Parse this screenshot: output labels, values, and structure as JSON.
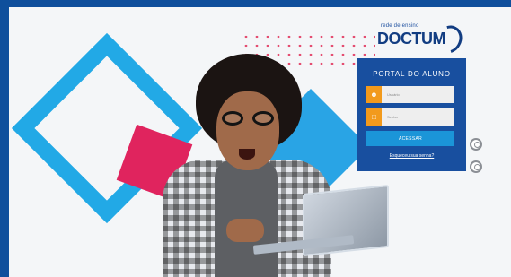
{
  "logo": {
    "small_text": "rede de ensino",
    "main_text": "DOCTUM"
  },
  "login": {
    "title": "PORTAL DO ALUNO",
    "user_placeholder": "Usuário",
    "password_placeholder": "Senha",
    "submit_label": "ACESSAR",
    "forgot_link": "Esqueceu sua senha?"
  },
  "icons": {
    "user_field_icon": "user-icon",
    "password_field_icon": "lock-icon",
    "side_icons": [
      "headset-icon",
      "headset-icon"
    ]
  },
  "colors": {
    "frame_blue": "#0f4f9c",
    "panel_blue": "#184f9f",
    "accent_orange": "#f29a1c",
    "button_blue": "#1b95d8",
    "accent_pink": "#e0245e",
    "accent_cyan": "#22a9e6"
  }
}
